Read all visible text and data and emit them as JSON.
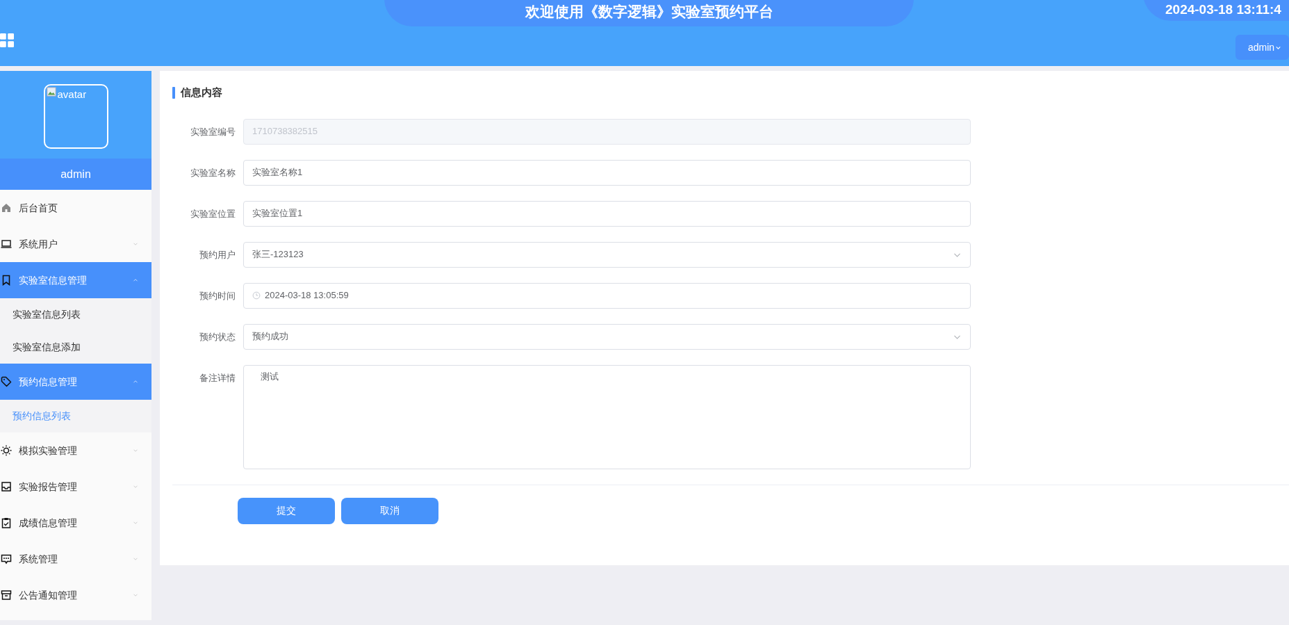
{
  "header": {
    "title": "欢迎使用《数字逻辑》实验室预约平台",
    "clock": "2024-03-18 13:11:4",
    "user_menu": "admin"
  },
  "sidebar": {
    "avatar_alt": "avatar",
    "username": "admin",
    "items": [
      {
        "label": "后台首页",
        "kind": "link"
      },
      {
        "label": "系统用户",
        "kind": "submenu",
        "expanded": false
      },
      {
        "label": "实验室信息管理",
        "kind": "submenu",
        "expanded": true,
        "children": [
          {
            "label": "实验室信息列表",
            "selected": false
          },
          {
            "label": "实验室信息添加",
            "selected": false
          }
        ]
      },
      {
        "label": "预约信息管理",
        "kind": "submenu",
        "expanded": true,
        "children": [
          {
            "label": "预约信息列表",
            "selected": true
          }
        ]
      },
      {
        "label": "模拟实验管理",
        "kind": "submenu",
        "expanded": false
      },
      {
        "label": "实验报告管理",
        "kind": "submenu",
        "expanded": false
      },
      {
        "label": "成绩信息管理",
        "kind": "submenu",
        "expanded": false
      },
      {
        "label": "系统管理",
        "kind": "submenu",
        "expanded": false
      },
      {
        "label": "公告通知管理",
        "kind": "submenu",
        "expanded": false
      }
    ]
  },
  "form": {
    "section_title": "信息内容",
    "fields": [
      {
        "label": "实验室编号",
        "kind": "text",
        "value": "1710738382515",
        "disabled": true
      },
      {
        "label": "实验室名称",
        "kind": "text",
        "value": "实验室名称1",
        "disabled": false
      },
      {
        "label": "实验室位置",
        "kind": "text",
        "value": "实验室位置1",
        "disabled": false
      },
      {
        "label": "预约用户",
        "kind": "select",
        "value": "张三-123123",
        "disabled": false
      },
      {
        "label": "预约时间",
        "kind": "datetime",
        "value": "2024-03-18 13:05:59",
        "disabled": false
      },
      {
        "label": "预约状态",
        "kind": "select",
        "value": "预约成功",
        "disabled": false
      },
      {
        "label": "备注详情",
        "kind": "textarea",
        "value": "测试",
        "disabled": false
      }
    ],
    "buttons": [
      "提交",
      "取消"
    ]
  }
}
